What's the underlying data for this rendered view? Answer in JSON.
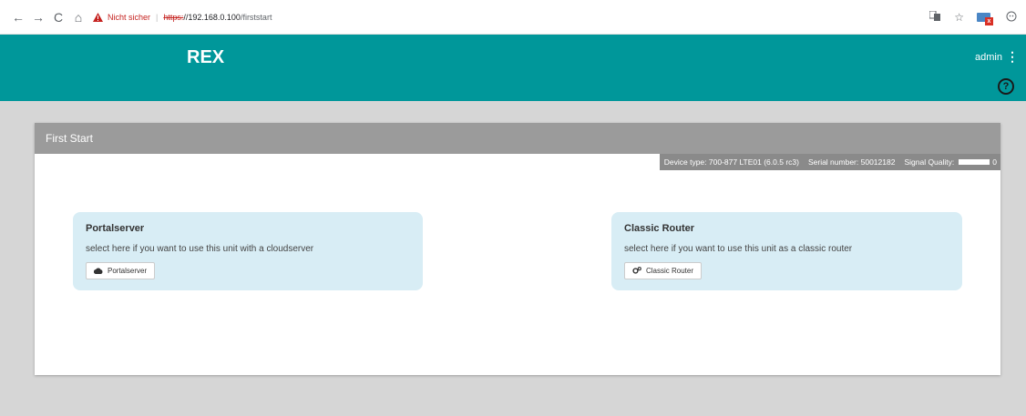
{
  "browser": {
    "back": "←",
    "forward": "→",
    "reload": "C",
    "home": "⌂",
    "security_text": "Nicht sicher",
    "separator": "|",
    "url_scheme": "https:",
    "url_host": "//192.168.0.100",
    "url_path": "/firststart",
    "translate_icon": "translate-icon",
    "star_icon": "star-icon",
    "extension_icon": "mail-extension-icon",
    "profile_icon": "profile-icon"
  },
  "header": {
    "brand": "REX",
    "user": "admin",
    "menu_glyph": "⋮",
    "help_glyph": "?"
  },
  "panel": {
    "title": "First Start",
    "device_type_label": "Device type:",
    "device_type_value": "700-877 LTE01 (6.0.5 rc3)",
    "serial_label": "Serial number:",
    "serial_value": "50012182",
    "signal_label": "Signal Quality:",
    "signal_value": "0"
  },
  "cards": {
    "portal": {
      "title": "Portalserver",
      "description": "select here if you want to use this unit with a cloudserver",
      "button_label": "Portalserver",
      "icon": "cloud-icon"
    },
    "classic": {
      "title": "Classic Router",
      "description": "select here if you want to use this unit as a classic router",
      "button_label": "Classic Router",
      "icon": "gears-icon"
    }
  },
  "colors": {
    "header_bg": "#00979a",
    "panel_head_bg": "#9b9b9b",
    "card_bg": "#d8edf5",
    "page_bg": "#d6d6d6",
    "warning": "#c5221f"
  }
}
